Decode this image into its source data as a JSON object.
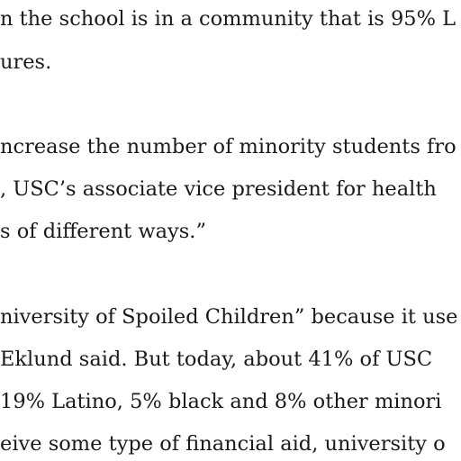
{
  "article": {
    "paragraphs": [
      {
        "lines": [
          "n the school is in a community that is 95% L",
          "ures."
        ]
      },
      {
        "lines": [
          "ncrease the number of minority students fro",
          ", USC’s associate vice president for health",
          "s of different ways.”"
        ]
      },
      {
        "lines": [
          "niversity of Spoiled Children” because it use",
          "Eklund said. But today, about 41% of USC",
          "19% Latino, 5% black and 8% other minori",
          "eive some type of financial aid, university o"
        ]
      }
    ]
  }
}
